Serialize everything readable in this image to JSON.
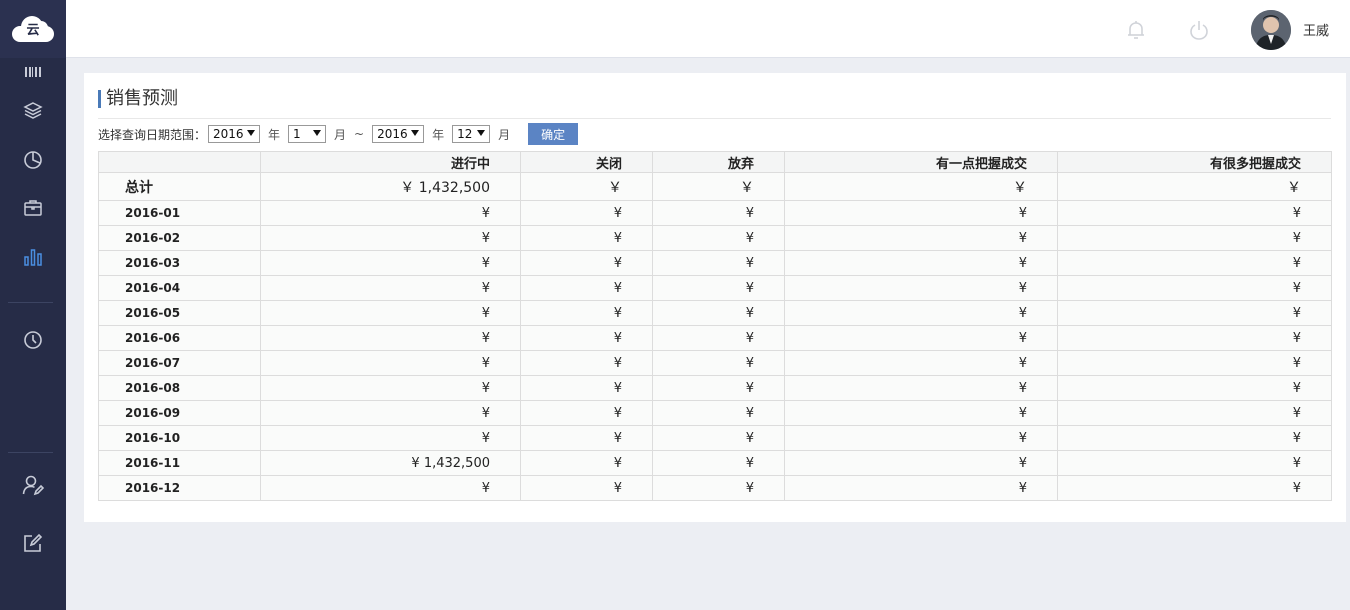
{
  "app": {
    "logo_text": "云"
  },
  "header": {
    "username": "王威"
  },
  "page": {
    "title": "销售预测"
  },
  "filter": {
    "label": "选择查询日期范围：",
    "start_year": "2016",
    "start_year_unit": "年",
    "start_month": "1",
    "start_month_unit": "月",
    "separator": "~",
    "end_year": "2016",
    "end_year_unit": "年",
    "end_month": "12",
    "end_month_unit": "月",
    "confirm_label": "确定"
  },
  "table": {
    "columns": [
      "",
      "进行中",
      "关闭",
      "放弃",
      "有一点把握成交",
      "有很多把握成交"
    ],
    "total": {
      "label": "总计",
      "cells": [
        "￥ 1,432,500",
        "￥",
        "￥",
        "￥",
        "￥"
      ]
    },
    "rows": [
      {
        "label": "2016-01",
        "cells": [
          "¥",
          "¥",
          "¥",
          "¥",
          "¥"
        ]
      },
      {
        "label": "2016-02",
        "cells": [
          "¥",
          "¥",
          "¥",
          "¥",
          "¥"
        ]
      },
      {
        "label": "2016-03",
        "cells": [
          "¥",
          "¥",
          "¥",
          "¥",
          "¥"
        ]
      },
      {
        "label": "2016-04",
        "cells": [
          "¥",
          "¥",
          "¥",
          "¥",
          "¥"
        ]
      },
      {
        "label": "2016-05",
        "cells": [
          "¥",
          "¥",
          "¥",
          "¥",
          "¥"
        ]
      },
      {
        "label": "2016-06",
        "cells": [
          "¥",
          "¥",
          "¥",
          "¥",
          "¥"
        ]
      },
      {
        "label": "2016-07",
        "cells": [
          "¥",
          "¥",
          "¥",
          "¥",
          "¥"
        ]
      },
      {
        "label": "2016-08",
        "cells": [
          "¥",
          "¥",
          "¥",
          "¥",
          "¥"
        ]
      },
      {
        "label": "2016-09",
        "cells": [
          "¥",
          "¥",
          "¥",
          "¥",
          "¥"
        ]
      },
      {
        "label": "2016-10",
        "cells": [
          "¥",
          "¥",
          "¥",
          "¥",
          "¥"
        ]
      },
      {
        "label": "2016-11",
        "cells": [
          "¥ 1,432,500",
          "¥",
          "¥",
          "¥",
          "¥"
        ]
      },
      {
        "label": "2016-12",
        "cells": [
          "¥",
          "¥",
          "¥",
          "¥",
          "¥"
        ]
      }
    ]
  },
  "icons": {
    "sidebar": [
      "barcode-icon",
      "layers-icon",
      "pie-chart-icon",
      "briefcase-icon",
      "bar-chart-icon",
      "clock-icon",
      "user-edit-icon",
      "edit-icon"
    ],
    "header": [
      "bell-icon",
      "power-icon"
    ]
  },
  "colors": {
    "sidebar_bg": "#262c47",
    "active_icon": "#4a8fe2",
    "inactive_icon": "#c8ccd8",
    "accent": "#5b84c4"
  }
}
